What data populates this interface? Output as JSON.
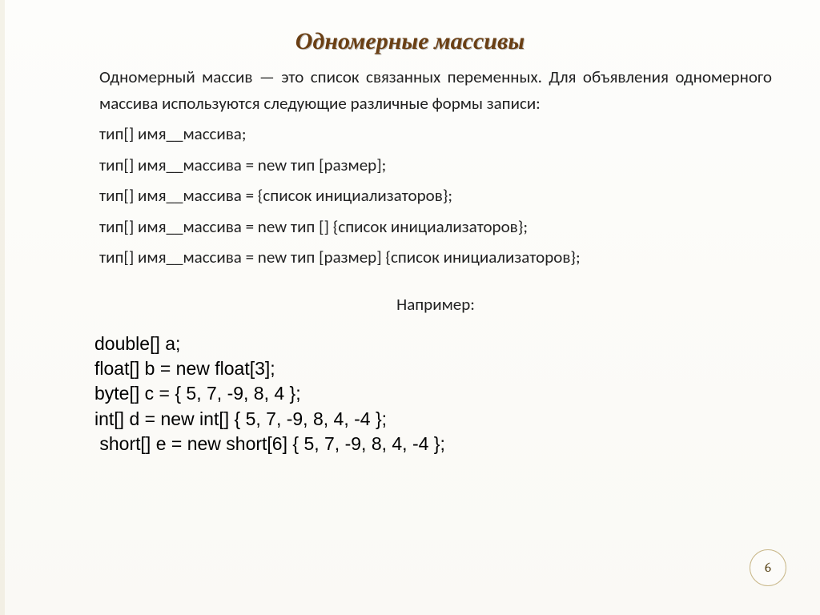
{
  "title": "Одномерные массивы",
  "intro": "Одномерный массив — это список связанных переменных. Для объявления одномерного массива используются следующие различные формы записи:",
  "syntax": [
    "тип[] имя__массива;",
    "тип[] имя__массива = new тип [размер];",
    "тип[] имя__массива = {список инициализаторов};",
    "тип[] имя__массива = new тип [] {список инициализаторов};",
    "тип[] имя__массива = new тип [размер] {список инициализаторов};"
  ],
  "example_label": "Например:",
  "code": [
    "double[] a;",
    "float[] b = new float[3];",
    "byte[] c = { 5, 7, -9, 8, 4 };",
    "int[] d = new int[] { 5, 7, -9, 8, 4, -4 };",
    " short[] e = new short[6] { 5, 7, -9, 8, 4, -4 };"
  ],
  "page_number": "6"
}
